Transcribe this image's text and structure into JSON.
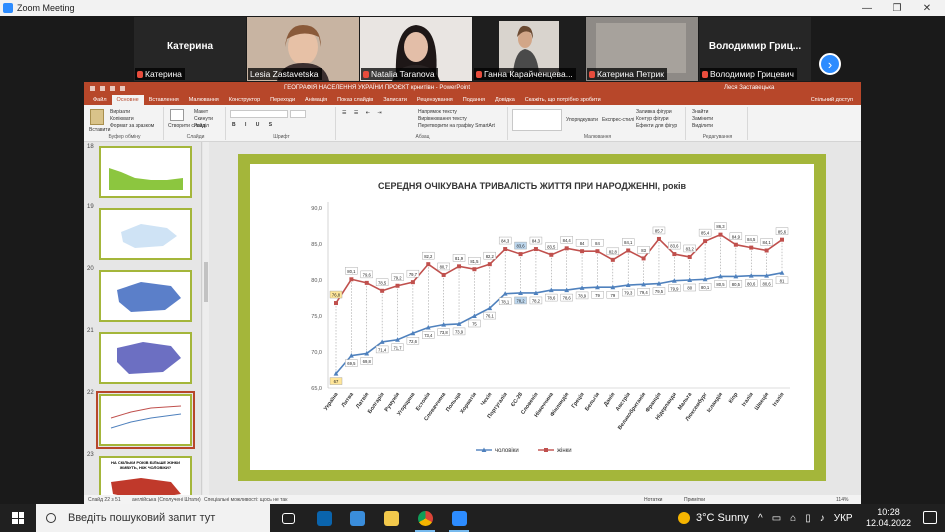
{
  "zoom": {
    "window_title": "Zoom Meeting",
    "next_arrow": "›",
    "participants": [
      {
        "big_name": "Катерина",
        "tag": "Катерина",
        "muted": true,
        "video": false
      },
      {
        "big_name": "",
        "tag": "Lesia Zastavetska",
        "muted": false,
        "video": true
      },
      {
        "big_name": "",
        "tag": "Natalia Taranova",
        "muted": true,
        "video": true
      },
      {
        "big_name": "",
        "tag": "Ганна Карайченцева...",
        "muted": true,
        "video": true
      },
      {
        "big_name": "",
        "tag": "Катерина Петрик",
        "muted": true,
        "video": true
      },
      {
        "big_name": "Володимир Гриц...",
        "tag": "Володимир Грицевич",
        "muted": true,
        "video": false
      }
    ]
  },
  "ppt": {
    "title": "ГЕОГРАФІЯ НАСЕЛЕННЯ УКРАЇНИ ПРОЄКТ крнитівн  -  PowerPoint",
    "user": "Леся Заставецька",
    "tabs": [
      "Файл",
      "Основне",
      "Вставлення",
      "Малювання",
      "Конструктор",
      "Переходи",
      "Анімація",
      "Показ слайдів",
      "Записати",
      "Рецензування",
      "Подання",
      "Довідка"
    ],
    "tell_me": "Скажіть, що потрібно зробити",
    "share": "Спільний доступ",
    "ribbon": {
      "clipboard": {
        "label": "Буфер обміну",
        "paste": "Вставити",
        "cut": "Вирізати",
        "copy": "Копіювати",
        "format": "Формат за зразком"
      },
      "slides": {
        "label": "Слайди",
        "new": "Створити слайд",
        "layout": "Макет",
        "reset": "Скинути",
        "section": "Розділ"
      },
      "font": {
        "label": "Шрифт"
      },
      "paragraph": {
        "label": "Абзац",
        "direction": "Напрямок тексту",
        "align": "Вирівнювання тексту",
        "smartart": "Перетворити на графіку SmartArt"
      },
      "drawing": {
        "label": "Малювання",
        "arrange": "Упорядкувати",
        "styles": "Експрес-стилі",
        "fill": "Заливка фігури",
        "outline": "Контур фігури",
        "effects": "Ефекти для фігур"
      },
      "editing": {
        "label": "Редагування",
        "find": "Знайти",
        "replace": "Замінити",
        "select": "Виділити"
      }
    },
    "thumbnails": [
      {
        "num": "18",
        "title": ""
      },
      {
        "num": "19",
        "title": ""
      },
      {
        "num": "20",
        "title": ""
      },
      {
        "num": "21",
        "title": ""
      },
      {
        "num": "22",
        "title": ""
      },
      {
        "num": "23",
        "title": "НА СКІЛЬКИ РОКІВ БІЛЬШЕ ЖІНКИ ЖИВУТЬ, НІЖ ЧОЛОВІКИ?"
      }
    ],
    "status": {
      "slide": "Слайд 22 з 51",
      "lang": "англійська (Сполучені Штати)",
      "accessibility": "Спеціальні можливості: щось не так",
      "notes": "Нотатки",
      "comments": "Примітки",
      "zoom": "114%"
    }
  },
  "chart_data": {
    "type": "line",
    "title": "СЕРЕДНЯ ОЧІКУВАНА ТРИВАЛІСТЬ ЖИТТЯ ПРИ НАРОДЖЕННІ, років",
    "categories": [
      "Україна",
      "Литва",
      "Латвія",
      "Болгарія",
      "Румунія",
      "Угорщина",
      "Естонія",
      "Словаччина",
      "Польща",
      "Хорватія",
      "Чехія",
      "Португалія",
      "ЄС-28",
      "Словенія",
      "Німеччина",
      "Фінляндія",
      "Греція",
      "Бельгія",
      "Данія",
      "Австрія",
      "Великобританія",
      "Франція",
      "Нідерланди",
      "Мальта",
      "Люксембург",
      "Ісландія",
      "Кіпр",
      "Італія",
      "Швеція",
      "Італія"
    ],
    "series": [
      {
        "name": "жінки",
        "color": "#c0504d",
        "values": [
          76.8,
          80.1,
          79.6,
          78.5,
          79.2,
          79.7,
          82.2,
          80.7,
          81.9,
          81.5,
          82.2,
          84.3,
          83.6,
          84.3,
          83.5,
          84.4,
          84.0,
          84.0,
          82.8,
          84.1,
          83.0,
          85.7,
          83.6,
          83.2,
          85.4,
          86.3,
          84.9,
          84.5,
          84.1,
          85.6
        ]
      },
      {
        "name": "чоловіки",
        "color": "#4f81bd",
        "values": [
          67.0,
          69.5,
          69.8,
          71.4,
          71.7,
          72.6,
          73.4,
          73.8,
          73.9,
          75.0,
          76.1,
          78.1,
          78.2,
          78.2,
          78.6,
          78.6,
          78.9,
          79.0,
          79.0,
          79.3,
          79.4,
          79.5,
          79.9,
          80.0,
          80.1,
          80.5,
          80.5,
          80.6,
          80.6,
          81.0
        ]
      }
    ],
    "y_ticks": [
      "65,0",
      "70,0",
      "75,0",
      "80,0",
      "85,0",
      "90,0"
    ],
    "ylim": [
      65,
      90
    ],
    "highlighted_labels": {
      "жінки": [
        0,
        12
      ],
      "чоловіки": [
        0,
        12
      ]
    },
    "legend": {
      "position": "bottom",
      "items": [
        "чоловіки",
        "жінки"
      ]
    }
  },
  "taskbar": {
    "search_placeholder": "Введіть пошуковий запит тут",
    "weather": "3°C  Sunny",
    "lang": "УКР",
    "time": "10:28",
    "date": "12.04.2022"
  }
}
